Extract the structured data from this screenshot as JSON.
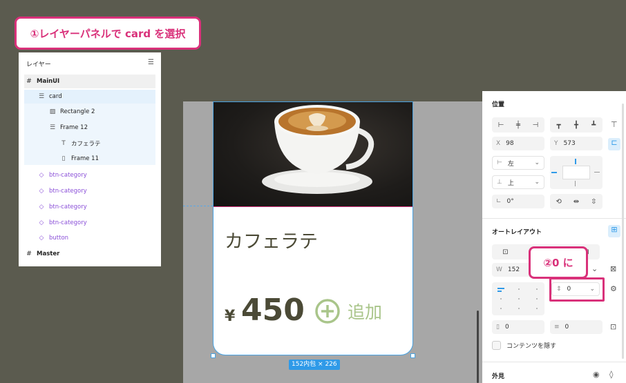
{
  "callout1": "①レイヤーパネルで card を選択",
  "callout2": "②0 に",
  "layers": {
    "header": "レイヤー",
    "items": [
      {
        "label": "MainUI",
        "icon": "#"
      },
      {
        "label": "card",
        "icon": "frame"
      },
      {
        "label": "Rectangle 2",
        "icon": "image"
      },
      {
        "label": "Frame 12",
        "icon": "autolayout"
      },
      {
        "label": "カフェラテ",
        "icon": "T"
      },
      {
        "label": "Frame 11",
        "icon": "autolayout"
      },
      {
        "label": "btn-category",
        "icon": "component"
      },
      {
        "label": "btn-category",
        "icon": "component"
      },
      {
        "label": "btn-category",
        "icon": "component"
      },
      {
        "label": "btn-category",
        "icon": "component"
      },
      {
        "label": "button",
        "icon": "component"
      },
      {
        "label": "Master",
        "icon": "#"
      }
    ]
  },
  "card": {
    "title": "カフェラテ",
    "currency": "¥",
    "price": "450",
    "add_label": "追加",
    "dimensions": "152内包 × 226"
  },
  "panel": {
    "position_title": "位置",
    "x_label": "X",
    "x_value": "98",
    "y_label": "Y",
    "y_value": "573",
    "h_constraint": "左",
    "v_constraint": "上",
    "rotation": "0°",
    "autolayout_title": "オートレイアウト",
    "w_label": "W",
    "w_value": "152",
    "gap_value": "0",
    "pad_h_value": "0",
    "pad_v_value": "0",
    "clip_label": "コンテンツを隠す",
    "appearance_title": "外見"
  },
  "colors": {
    "accent": "#d9317a",
    "selection": "#2f9ae8",
    "text_olive": "#4b4a36",
    "add_green": "#a9c58a"
  }
}
